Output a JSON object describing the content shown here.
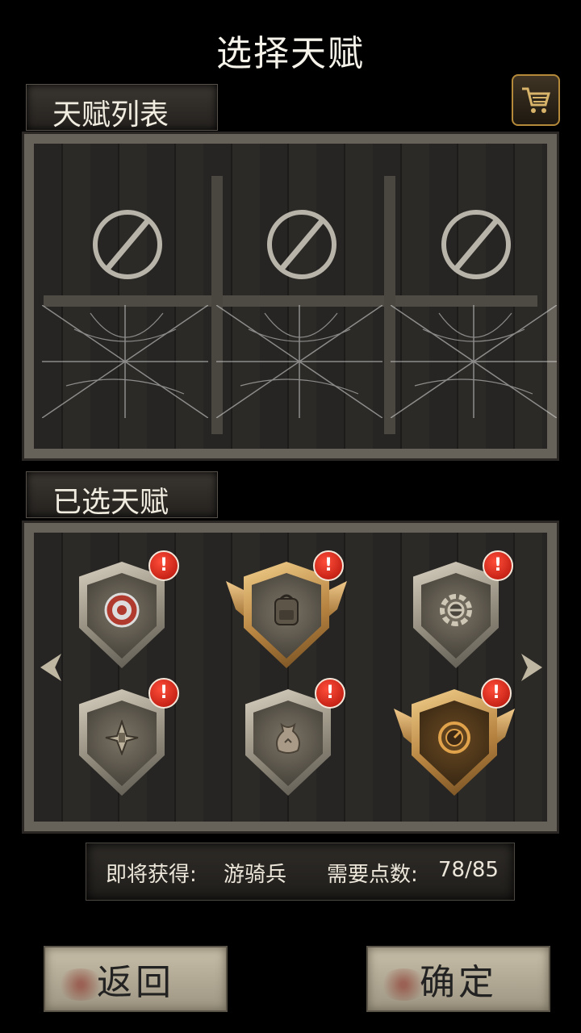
{
  "header": {
    "title": "选择天赋"
  },
  "talent_list": {
    "label": "天赋列表",
    "slots": [
      {
        "state": "locked",
        "icon": "forbidden-icon"
      },
      {
        "state": "locked",
        "icon": "forbidden-icon"
      },
      {
        "state": "locked",
        "icon": "forbidden-icon"
      }
    ]
  },
  "shop": {
    "icon": "cart-icon"
  },
  "selected": {
    "label": "已选天赋",
    "talents": [
      {
        "icon": "target-icon",
        "frame": "silver",
        "alert": "!"
      },
      {
        "icon": "backpack-icon",
        "frame": "gold-winged",
        "alert": "!"
      },
      {
        "icon": "gear-shield-icon",
        "frame": "silver",
        "alert": "!"
      },
      {
        "icon": "blades-icon",
        "frame": "silver",
        "alert": "!"
      },
      {
        "icon": "pouch-icon",
        "frame": "silver",
        "alert": "!"
      },
      {
        "icon": "dial-icon",
        "frame": "gold-winged",
        "alert": "!"
      }
    ]
  },
  "info": {
    "obtain_label": "即将获得:",
    "obtain_value": "游骑兵",
    "points_label": "需要点数:",
    "points_value": "78/85"
  },
  "buttons": {
    "back": "返回",
    "confirm": "确定"
  },
  "colors": {
    "alert": "#d6231a",
    "gold": "#c8954a",
    "silver": "#b7b0a0"
  }
}
